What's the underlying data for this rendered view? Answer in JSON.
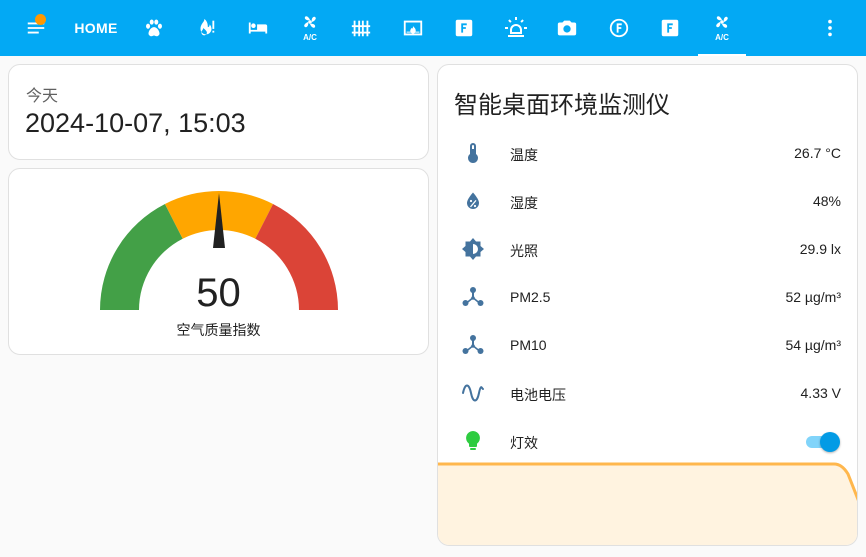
{
  "toolbar": {
    "home_label": "HOME",
    "items": [
      {
        "icon": "paw-icon"
      },
      {
        "icon": "fire-alert-icon"
      },
      {
        "icon": "bed-icon"
      },
      {
        "icon": "air-conditioner-icon",
        "label": "A/C"
      },
      {
        "icon": "radiator-icon"
      },
      {
        "icon": "fireplace-icon"
      },
      {
        "icon": "alpha-f-box-icon",
        "label": "F"
      },
      {
        "icon": "alarm-light-icon"
      },
      {
        "icon": "camera-icon"
      },
      {
        "icon": "alpha-f-circle-icon",
        "label": "F"
      },
      {
        "icon": "alpha-f-box-icon",
        "label": "F"
      },
      {
        "icon": "air-conditioner-icon",
        "label": "A/C",
        "active": true
      }
    ],
    "colors": {
      "bar": "#03a9f4",
      "badge": "#ff9800"
    }
  },
  "date_card": {
    "label": "今天",
    "value": "2024-10-07, 15:03"
  },
  "gauge": {
    "value": "50",
    "value_num": 50,
    "min": 0,
    "max": 100,
    "name": "空气质量指数",
    "segments": [
      {
        "from": 0,
        "to": 35,
        "color": "#43a047"
      },
      {
        "from": 35,
        "to": 65,
        "color": "#ffa600"
      },
      {
        "from": 65,
        "to": 100,
        "color": "#db4437"
      }
    ]
  },
  "entities": {
    "title": "智能桌面环境监测仪",
    "rows": [
      {
        "name": "温度",
        "value": "26.7 °C",
        "icon": "thermometer-icon"
      },
      {
        "name": "湿度",
        "value": "48%",
        "icon": "water-percent-icon"
      },
      {
        "name": "光照",
        "value": "29.9 lx",
        "icon": "brightness-icon"
      },
      {
        "name": "PM2.5",
        "value": "52 µg/m³",
        "icon": "molecule-icon"
      },
      {
        "name": "PM10",
        "value": "54 µg/m³",
        "icon": "molecule-icon"
      },
      {
        "name": "电池电压",
        "value": "4.33 V",
        "icon": "sine-wave-icon"
      },
      {
        "name": "灯效",
        "icon": "lightbulb-icon",
        "toggle": true,
        "state": "on"
      }
    ],
    "colors": {
      "icon": "#44739e",
      "light_on": "#2ecc40",
      "history_line": "#ffb74d"
    }
  }
}
